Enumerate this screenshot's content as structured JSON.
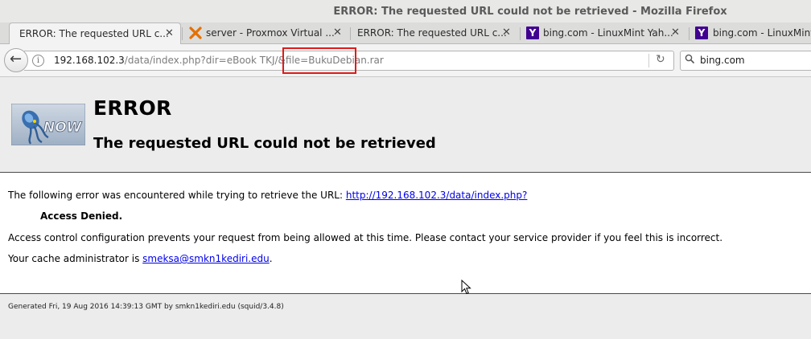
{
  "window": {
    "title": "ERROR: The requested URL could not be retrieved - Mozilla Firefox"
  },
  "tabs": [
    {
      "label": "ERROR: The requested URL c...",
      "icon": "none",
      "active": true
    },
    {
      "label": "server - Proxmox Virtual ...",
      "icon": "proxmox-icon",
      "active": false
    },
    {
      "label": "ERROR: The requested URL c...",
      "icon": "none",
      "active": false
    },
    {
      "label": "bing.com - LinuxMint Yah...",
      "icon": "yahoo-icon",
      "active": false
    },
    {
      "label": "bing.com - LinuxMint Y",
      "icon": "yahoo-icon",
      "active": false
    }
  ],
  "navbar": {
    "url_host": "192.168.102.3",
    "url_path": "/data/index.php?dir=eBook TKJ/&file=BukuDebian.rar",
    "search_value": "bing.com"
  },
  "icons": {
    "yahoo_glyph": "Y",
    "close_glyph": "✕",
    "back_glyph": "←",
    "reload_glyph": "↻",
    "info_glyph": "i"
  },
  "page": {
    "logo_text": "NOW",
    "heading": "ERROR",
    "subheading": "The requested URL could not be retrieved",
    "intro": "The following error was encountered while trying to retrieve the URL: ",
    "url_link": "http://192.168.102.3/data/index.php?",
    "denied": "Access Denied.",
    "explanation": "Access control configuration prevents your request from being allowed at this time. Please contact your service provider if you feel this is incorrect.",
    "admin_prefix": "Your cache administrator is ",
    "admin_email": "smeksa@smkn1kediri.edu",
    "admin_suffix": ".",
    "footer": "Generated Fri, 19 Aug 2016 14:39:13 GMT by smkn1kediri.edu (squid/3.4.8)"
  },
  "colors": {
    "highlight": "#e01a1a",
    "link": "#0000ee",
    "yahoo": "#400090",
    "proxmox": "#e57000"
  }
}
